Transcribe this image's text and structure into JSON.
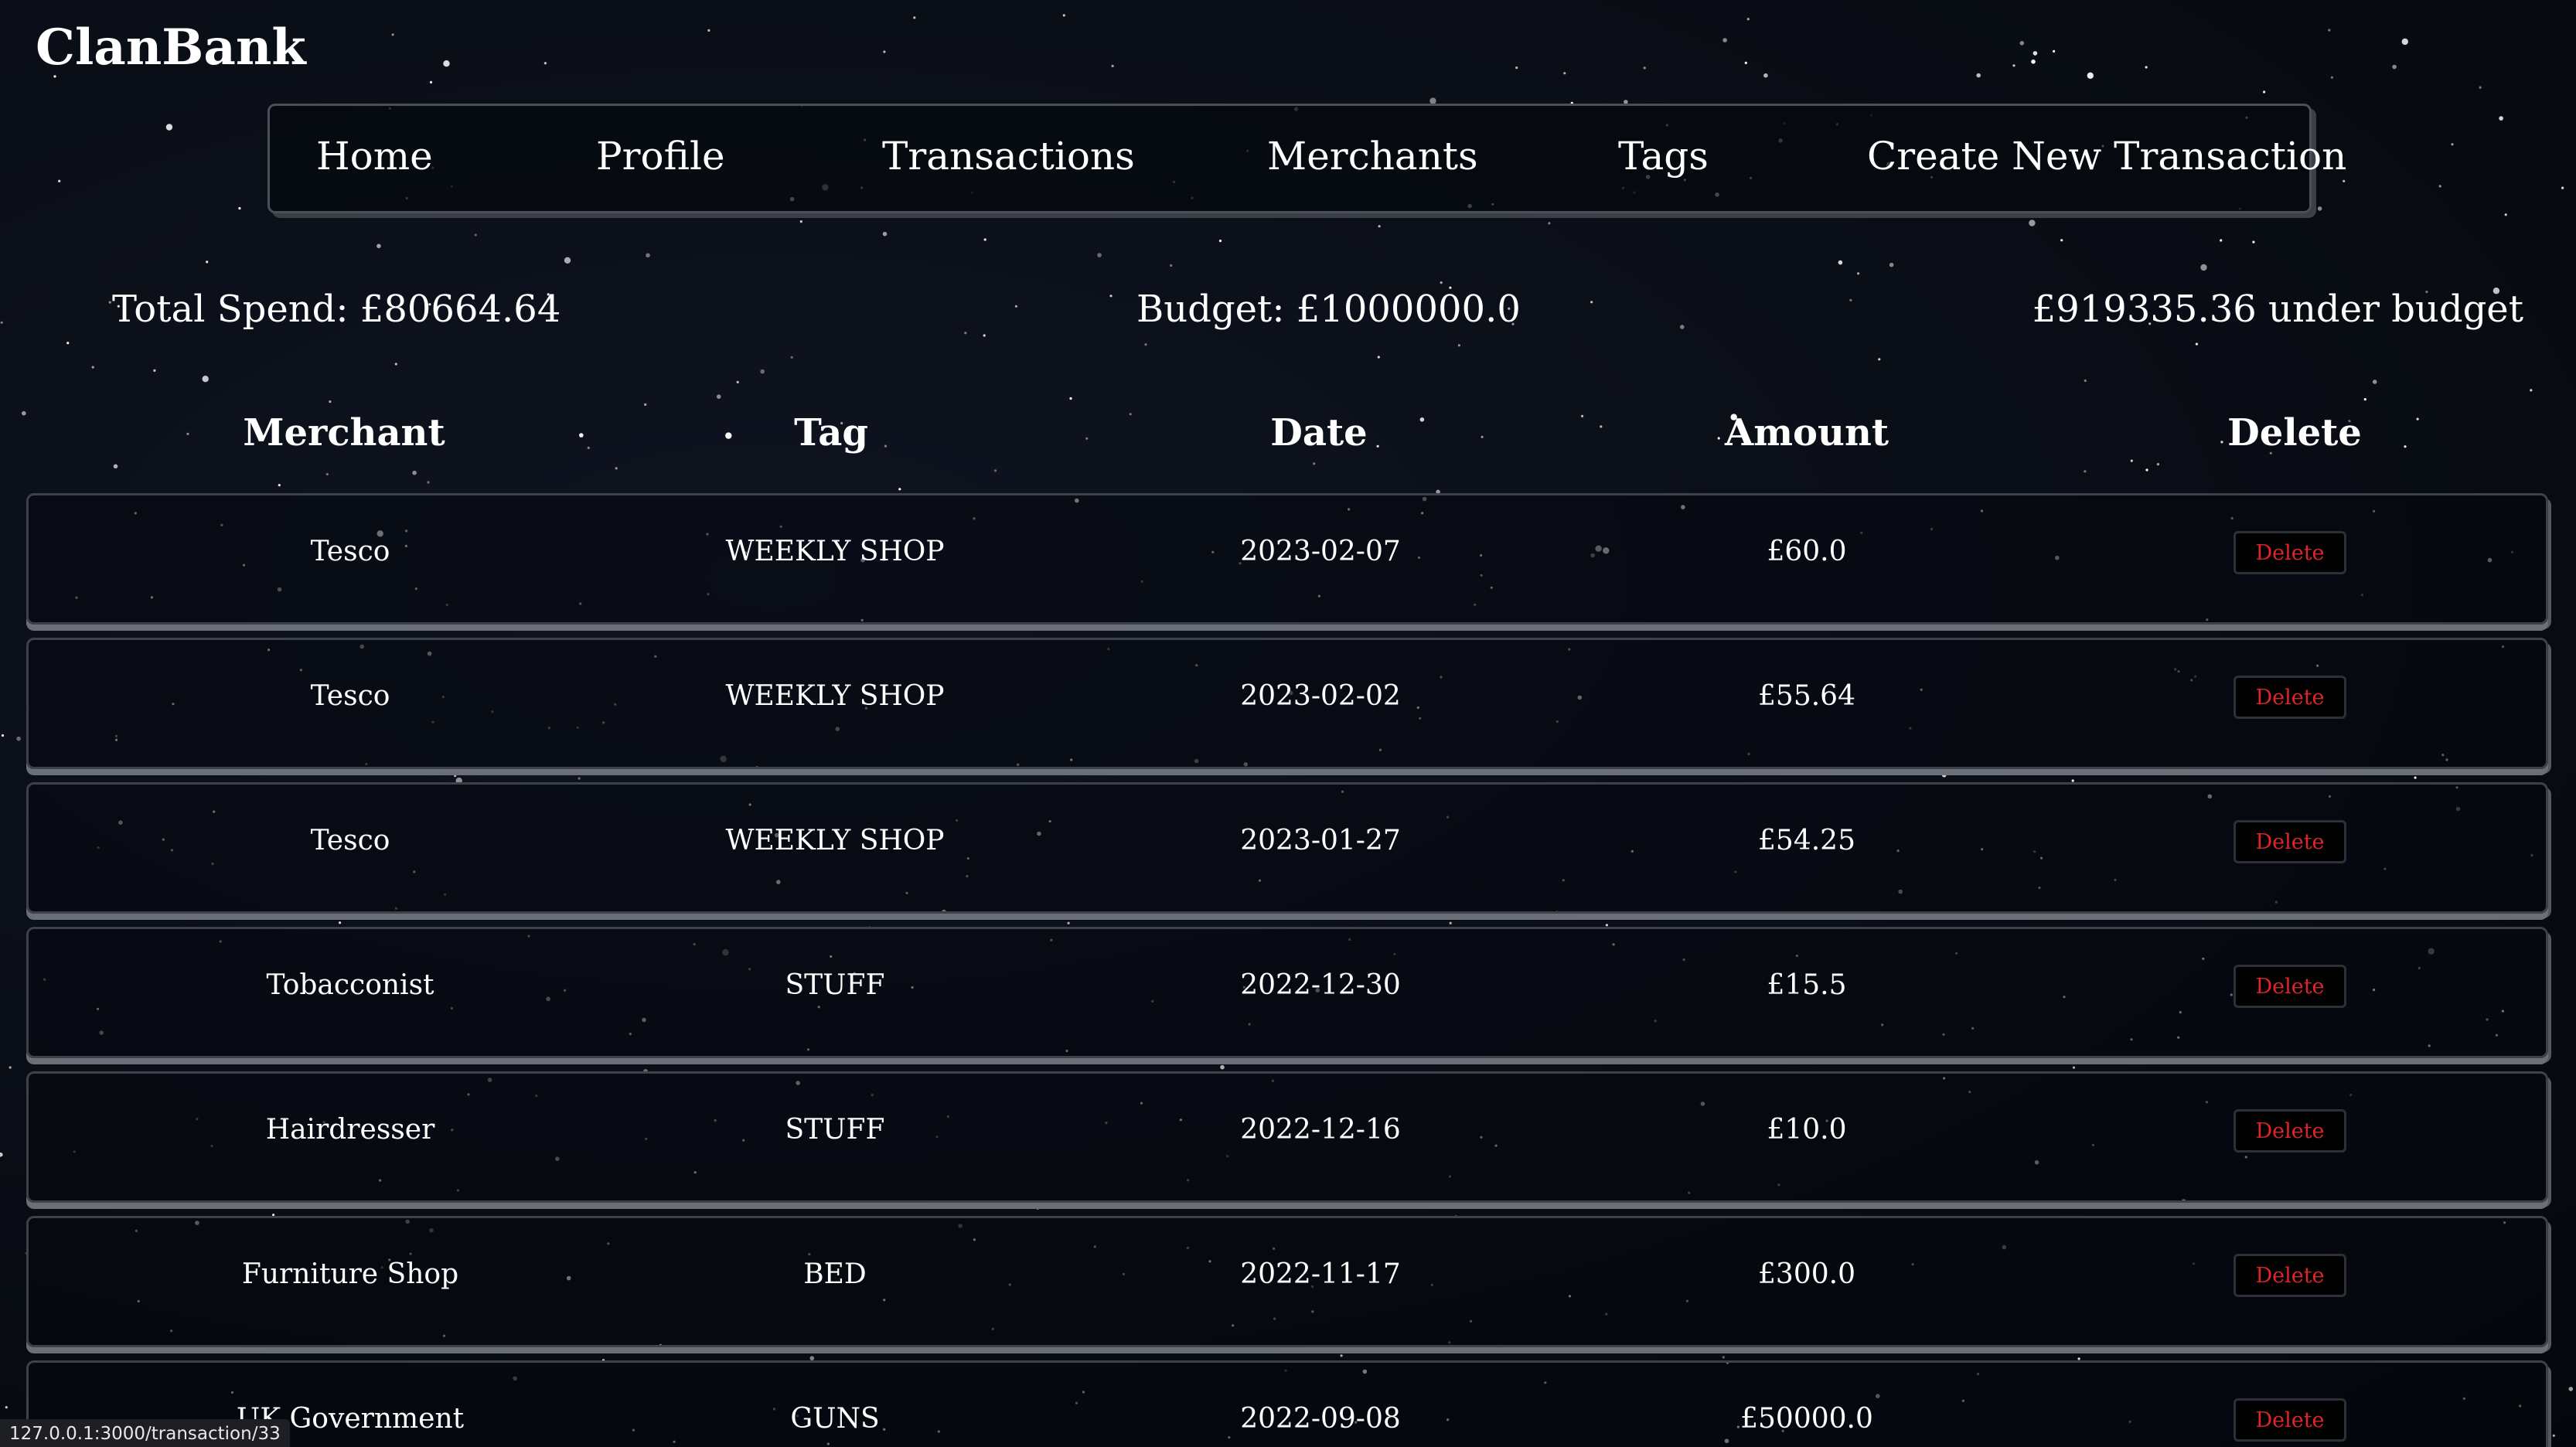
{
  "app": {
    "brand": "ClanBank"
  },
  "nav": {
    "items": [
      {
        "label": "Home"
      },
      {
        "label": "Profile"
      },
      {
        "label": "Transactions"
      },
      {
        "label": "Merchants"
      },
      {
        "label": "Tags"
      },
      {
        "label": "Create New Transaction"
      }
    ]
  },
  "summary": {
    "total_spend": "Total Spend: £80664.64",
    "budget": "Budget: £1000000.0",
    "status": "£919335.36 under budget"
  },
  "table": {
    "headers": [
      "Merchant",
      "Tag",
      "Date",
      "Amount",
      "Delete"
    ],
    "rows": [
      {
        "merchant": "Tesco",
        "tag": "WEEKLY SHOP",
        "date": "2023-02-07",
        "amount": "£60.0",
        "delete": "Delete"
      },
      {
        "merchant": "Tesco",
        "tag": "WEEKLY SHOP",
        "date": "2023-02-02",
        "amount": "£55.64",
        "delete": "Delete"
      },
      {
        "merchant": "Tesco",
        "tag": "WEEKLY SHOP",
        "date": "2023-01-27",
        "amount": "£54.25",
        "delete": "Delete"
      },
      {
        "merchant": "Tobacconist",
        "tag": "STUFF",
        "date": "2022-12-30",
        "amount": "£15.5",
        "delete": "Delete"
      },
      {
        "merchant": "Hairdresser",
        "tag": "STUFF",
        "date": "2022-12-16",
        "amount": "£10.0",
        "delete": "Delete"
      },
      {
        "merchant": "Furniture Shop",
        "tag": "BED",
        "date": "2022-11-17",
        "amount": "£300.0",
        "delete": "Delete"
      },
      {
        "merchant": "UK Government",
        "tag": "GUNS",
        "date": "2022-09-08",
        "amount": "£50000.0",
        "delete": "Delete"
      }
    ]
  },
  "status_bar": {
    "url": "127.0.0.1:3000/transaction/33"
  },
  "colors": {
    "background": "#0a0e17",
    "text": "#ffffff",
    "delete_text": "#e0242a",
    "border": "#4a4f58"
  }
}
